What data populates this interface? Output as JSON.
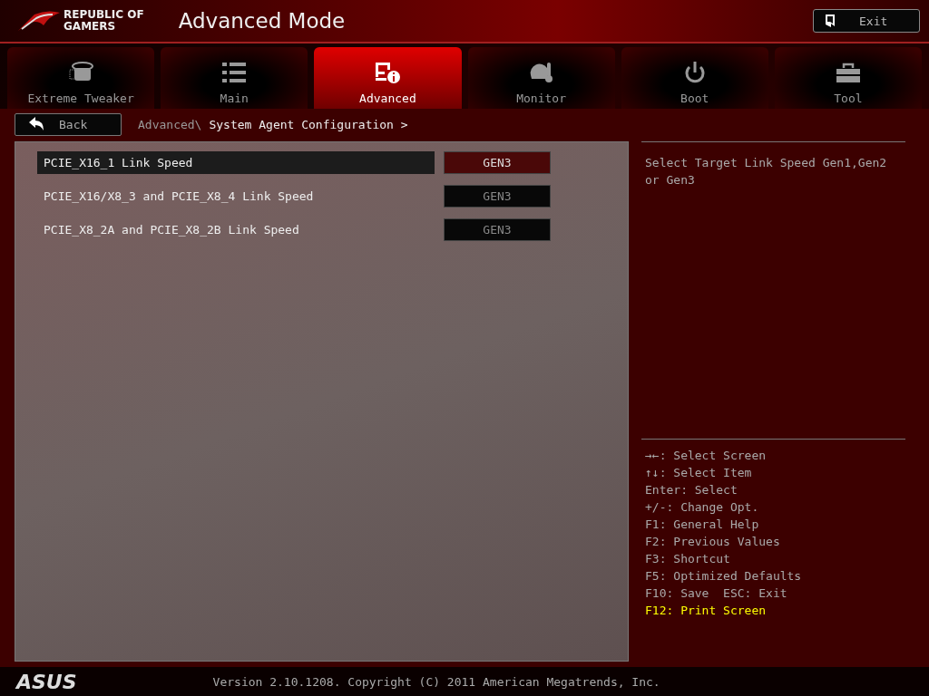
{
  "header": {
    "logo_line1": "REPUBLIC OF",
    "logo_line2": "GAMERS",
    "title": "Advanced Mode",
    "exit_button": "Exit"
  },
  "tabs": [
    {
      "label": "Extreme Tweaker",
      "kind": "tweaker",
      "selected": false
    },
    {
      "label": "Main",
      "kind": "list",
      "selected": false
    },
    {
      "label": "Advanced",
      "kind": "advanced",
      "selected": true
    },
    {
      "label": "Monitor",
      "kind": "monitor",
      "selected": false
    },
    {
      "label": "Boot",
      "kind": "power",
      "selected": false
    },
    {
      "label": "Tool",
      "kind": "toolbox",
      "selected": false
    }
  ],
  "back_button": "Back",
  "breadcrumb": {
    "parent": "Advanced\\",
    "current": "System Agent Configuration >"
  },
  "settings": [
    {
      "label": "PCIE_X16_1 Link Speed",
      "value": "GEN3",
      "selected": true
    },
    {
      "label": "PCIE_X16/X8_3 and PCIE_X8_4 Link Speed",
      "value": "GEN3",
      "selected": false
    },
    {
      "label": "PCIE_X8_2A and PCIE_X8_2B Link Speed",
      "value": "GEN3",
      "selected": false
    }
  ],
  "help_text": "Select Target Link Speed Gen1,Gen2 or Gen3",
  "key_hints": [
    {
      "text": "→←: Select Screen",
      "highlighted": false
    },
    {
      "text": "↑↓: Select Item",
      "highlighted": false
    },
    {
      "text": "Enter: Select",
      "highlighted": false
    },
    {
      "text": "+/-: Change Opt.",
      "highlighted": false
    },
    {
      "text": "F1: General Help",
      "highlighted": false
    },
    {
      "text": "F2: Previous Values",
      "highlighted": false
    },
    {
      "text": "F3: Shortcut",
      "highlighted": false
    },
    {
      "text": "F5: Optimized Defaults",
      "highlighted": false
    },
    {
      "text": "F10: Save  ESC: Exit",
      "highlighted": false
    },
    {
      "text": "F12: Print Screen",
      "highlighted": true
    }
  ],
  "footer": {
    "brand": "ASUS",
    "version": "Version 2.10.1208. Copyright (C) 2011 American Megatrends, Inc."
  }
}
